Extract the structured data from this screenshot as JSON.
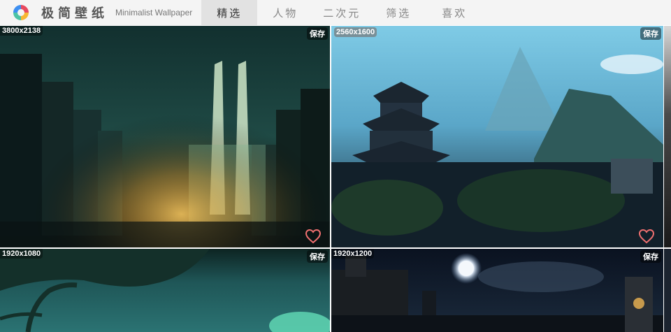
{
  "header": {
    "brand_cn": "极简壁纸",
    "brand_en": "Minimalist Wallpaper",
    "tabs": [
      {
        "label": "精选",
        "active": true
      },
      {
        "label": "人物",
        "active": false
      },
      {
        "label": "二次元",
        "active": false
      },
      {
        "label": "筛选",
        "active": false
      },
      {
        "label": "喜欢",
        "active": false
      }
    ]
  },
  "wallpapers": [
    {
      "resolution": "3800x2138",
      "save_label": "保存"
    },
    {
      "resolution": "2560x1600",
      "save_label": "保存"
    },
    {
      "resolution": "1920x1080",
      "save_label": "保存"
    },
    {
      "resolution": "1920x1200",
      "save_label": "保存"
    }
  ],
  "colors": {
    "topbar_bg": "#f4f4f4",
    "active_tab_bg": "#e2e2e2",
    "heart_outline": "#f07070"
  },
  "icons": {
    "logo": "colorful-ring-logo",
    "favorite": "heart-outline-icon"
  }
}
